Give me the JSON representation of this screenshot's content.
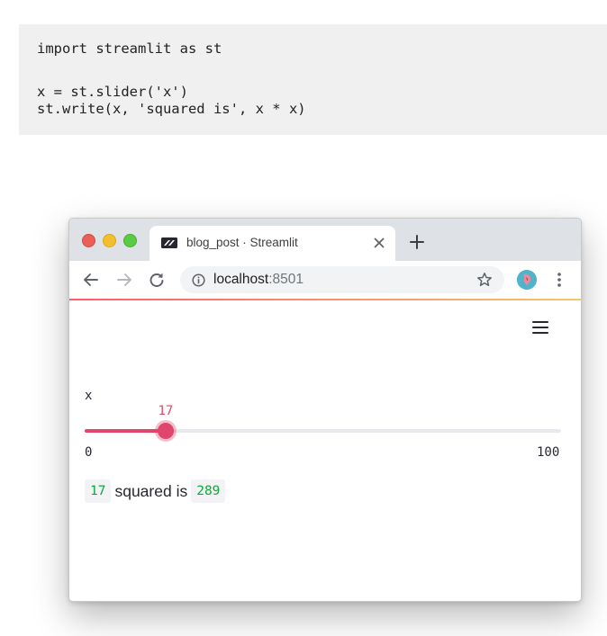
{
  "code": {
    "lines": [
      "import streamlit as st",
      "",
      "x = st.slider('x')",
      "st.write(x, 'squared is', x * x)"
    ]
  },
  "browser": {
    "tab": {
      "title": "blog_post · Streamlit",
      "favicon": "streamlit-logo-icon"
    },
    "url": {
      "host": "localhost",
      "port": ":8501"
    },
    "icons": {
      "back": "back-arrow-icon",
      "forward": "forward-arrow-icon",
      "reload": "reload-icon",
      "info": "info-icon",
      "bookmark": "star-icon",
      "menu": "kebab-menu-icon",
      "new_tab": "plus-icon",
      "close_tab": "close-icon"
    },
    "accent": "#e0466b"
  },
  "app": {
    "menu_icon": "hamburger-icon",
    "slider": {
      "label": "x",
      "value": 17,
      "value_text": "17",
      "min": 0,
      "max": 100,
      "min_text": "0",
      "max_text": "100"
    },
    "output": {
      "x": "17",
      "text": "squared is",
      "result": "289"
    }
  }
}
